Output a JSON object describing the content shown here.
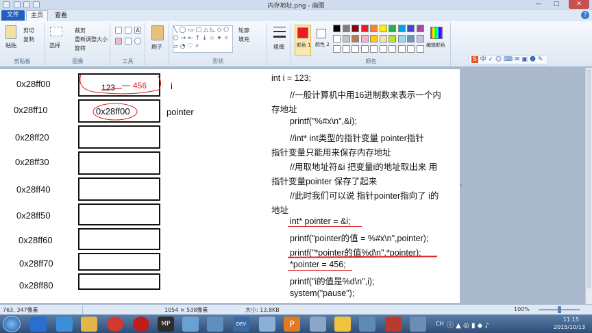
{
  "window": {
    "title": "内存地址.png - 画图"
  },
  "tabs": {
    "file": "文件",
    "home": "主页",
    "view": "查看"
  },
  "ribbon": {
    "clipboard": {
      "paste": "粘贴",
      "cut": "剪切",
      "copy": "复制",
      "label": "剪贴板"
    },
    "image": {
      "crop": "裁剪",
      "select": "选择",
      "resize": "重新调整大小",
      "rotate": "旋转",
      "label": "图像"
    },
    "tools": {
      "label": "工具"
    },
    "brushes": {
      "label": "刷子"
    },
    "shapes": {
      "outline": "轮廓",
      "fill": "填充",
      "label": "形状"
    },
    "size": {
      "label": "粗细"
    },
    "colors": {
      "color1": "颜色 1",
      "color2": "颜色 2",
      "edit": "编辑颜色",
      "label": "颜色"
    }
  },
  "memory": {
    "addresses": [
      "0x28ff00",
      "0x28ff10",
      "0x28ff20",
      "0x28ff30",
      "0x28ff40",
      "0x28ff50",
      "0x28ff60",
      "0x28ff70",
      "0x28ff80"
    ],
    "cell0_value_old": "123",
    "cell0_value_new": "456",
    "cell0_name": "i",
    "cell1_value": "0x28ff00",
    "cell1_name": "pointer"
  },
  "code": [
    "int i = 123;",
    "//一般计算机中用16进制数来表示一个内",
    "存地址",
    "printf(\"%#x\\n\",&i);",
    "//int* int类型的指针变量  pointer指针",
    "指针变量只能用来保存内存地址",
    "//用取地址符&i 把变量i的地址取出来 用",
    "指针变量pointer 保存了起来",
    "//此时我们可以说 指针pointer指向了 i的",
    "地址",
    "int* pointer = &i;",
    "printf(\"pointer的值 = %#x\\n\",pointer);",
    "printf(\"*pointer的值%d\\n\",*pointer);",
    "*pointer = 456;",
    "printf(\"i的值是%d\\n\",i);",
    "system(\"pause\");"
  ],
  "status": {
    "cursor": "763, 347像素",
    "dimensions": "1054 × 538像素",
    "filesize": "大小: 13.8KB",
    "zoom": "100%"
  },
  "taskbar": {
    "time": "11:15",
    "date": "2015/10/13",
    "lang": "CH"
  },
  "colors": {
    "accent": "#1f5fbf",
    "color1": "#ed1c24",
    "ink_red": "#dd2222"
  }
}
